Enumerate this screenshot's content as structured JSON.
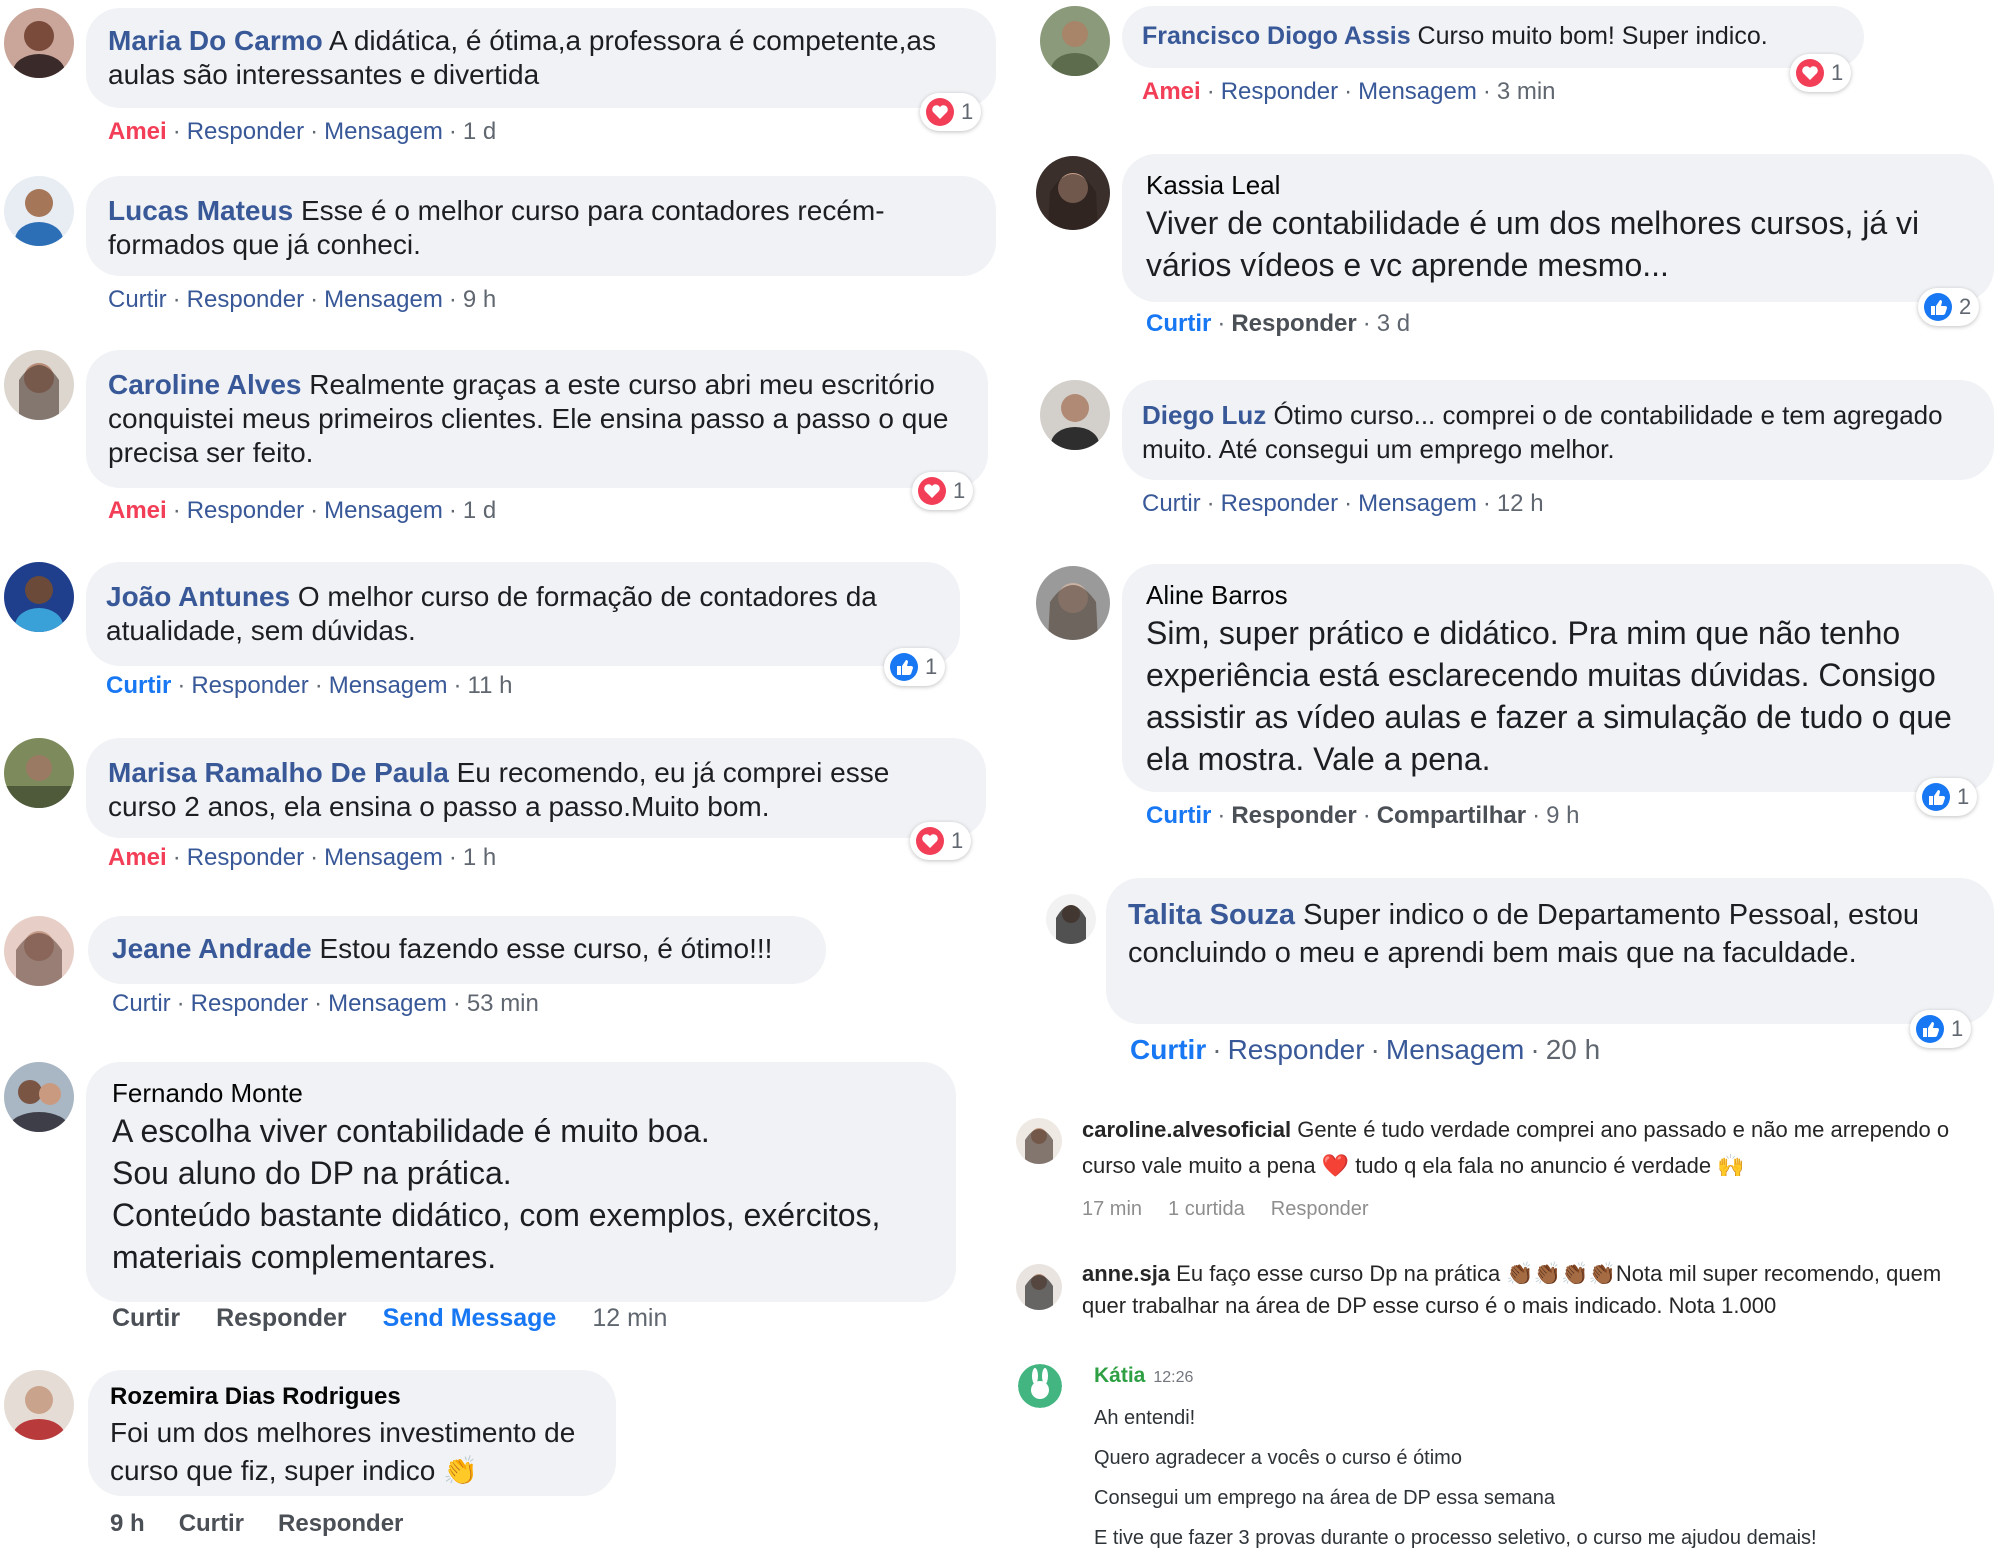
{
  "left": {
    "comments": [
      {
        "name": "Maria Do Carmo",
        "text": "A didática, é ótima,a professora é competente,as aulas são interessantes e divertida",
        "meta": [
          "Amei",
          "Responder",
          "Mensagem",
          "1 d"
        ],
        "reaction": {
          "type": "love",
          "count": "1"
        }
      },
      {
        "name": "Lucas Mateus",
        "text": "Esse é o melhor curso para contadores recém-formados que já conheci.",
        "meta": [
          "Curtir",
          "Responder",
          "Mensagem",
          "9 h"
        ]
      },
      {
        "name": "Caroline Alves",
        "text": "Realmente graças a este curso abri meu escritório conquistei meus primeiros clientes. Ele ensina passo a passo o que precisa ser feito.",
        "meta": [
          "Amei",
          "Responder",
          "Mensagem",
          "1 d"
        ],
        "reaction": {
          "type": "love",
          "count": "1"
        }
      },
      {
        "name": "João Antunes",
        "text": "O melhor curso de formação de contadores da atualidade, sem dúvidas.",
        "meta": [
          "Curtir",
          "Responder",
          "Mensagem",
          "11 h"
        ],
        "reaction": {
          "type": "like",
          "count": "1"
        }
      },
      {
        "name": "Marisa Ramalho De Paula",
        "text": "Eu recomendo, eu já comprei esse curso 2 anos, ela ensina o passo a passo.Muito bom.",
        "meta": [
          "Amei",
          "Responder",
          "Mensagem",
          "1 h"
        ],
        "reaction": {
          "type": "love",
          "count": "1"
        }
      },
      {
        "name": "Jeane Andrade",
        "text": "Estou fazendo esse curso, é ótimo!!!",
        "meta": [
          "Curtir",
          "Responder",
          "Mensagem",
          "53 min"
        ]
      },
      {
        "name": "Fernando Monte",
        "lines": [
          "A escolha viver contabilidade é muito boa.",
          "Sou aluno do DP na prática.",
          "Conteúdo bastante didático, com exemplos, exércitos, materiais complementares."
        ],
        "meta": [
          "Curtir",
          "Responder",
          "Send Message",
          "12 min"
        ]
      },
      {
        "name": "Rozemira Dias Rodrigues",
        "text": "Foi um dos melhores investimento de curso que fiz, super indico 👏",
        "meta": [
          "9 h",
          "Curtir",
          "Responder"
        ]
      }
    ]
  },
  "right": {
    "comments": [
      {
        "name": "Francisco Diogo Assis",
        "text": "Curso muito bom! Super indico.",
        "meta": [
          "Amei",
          "Responder",
          "Mensagem",
          "3 min"
        ],
        "reaction": {
          "type": "love",
          "count": "1"
        }
      },
      {
        "name": "Kassia Leal",
        "text": "Viver de contabilidade é um dos melhores cursos, já vi vários vídeos e vc aprende mesmo...",
        "meta": [
          "Curtir",
          "Responder",
          "3 d"
        ],
        "reaction": {
          "type": "like",
          "count": "2"
        }
      },
      {
        "name": "Diego Luz",
        "text": "Ótimo curso... comprei o de contabilidade e tem agregado muito. Até consegui um emprego melhor.",
        "meta": [
          "Curtir",
          "Responder",
          "Mensagem",
          "12 h"
        ]
      },
      {
        "name": "Aline Barros",
        "text": "Sim, super prático e didático. Pra mim que não tenho experiência está esclarecendo muitas dúvidas. Consigo assistir as vídeo aulas e fazer a simulação de tudo o que ela mostra. Vale a pena.",
        "meta": [
          "Curtir",
          "Responder",
          "Compartilhar",
          "9 h"
        ],
        "reaction": {
          "type": "like",
          "count": "1"
        }
      },
      {
        "name": "Talita Souza",
        "text": "Super indico o de Departamento Pessoal, estou concluindo o meu e aprendi bem mais que na faculdade.",
        "meta": [
          "Curtir",
          "Responder",
          "Mensagem",
          "20 h"
        ],
        "reaction": {
          "type": "like",
          "count": "1"
        }
      }
    ],
    "instagram": [
      {
        "user": "caroline.alvesoficial",
        "text": "Gente é tudo verdade comprei ano passado e não me arrependo o curso vale muito a pena ❤️ tudo q ela fala no anuncio é verdade 🙌",
        "meta": [
          "17 min",
          "1 curtida",
          "Responder"
        ]
      },
      {
        "user": "anne.sja",
        "text": "Eu faço esse curso Dp na prática 👏🏾👏🏾👏🏾👏🏾Nota mil super recomendo, quem quer trabalhar na área de DP esse curso é o mais indicado. Nota 1.000"
      }
    ],
    "chat": {
      "name": "Kátia",
      "time": "12:26",
      "lines": [
        "Ah entendi!",
        "Quero agradecer a vocês o curso é ótimo",
        "Consegui um emprego na área de DP essa semana",
        "E tive que fazer 3 provas durante o processo seletivo, o curso me ajudou demais!"
      ]
    }
  },
  "colors": {
    "link": "#385898",
    "love": "#f33e58",
    "like": "#1877f2",
    "bubble": "#f0f2f5",
    "chat_name": "#2ea043"
  }
}
